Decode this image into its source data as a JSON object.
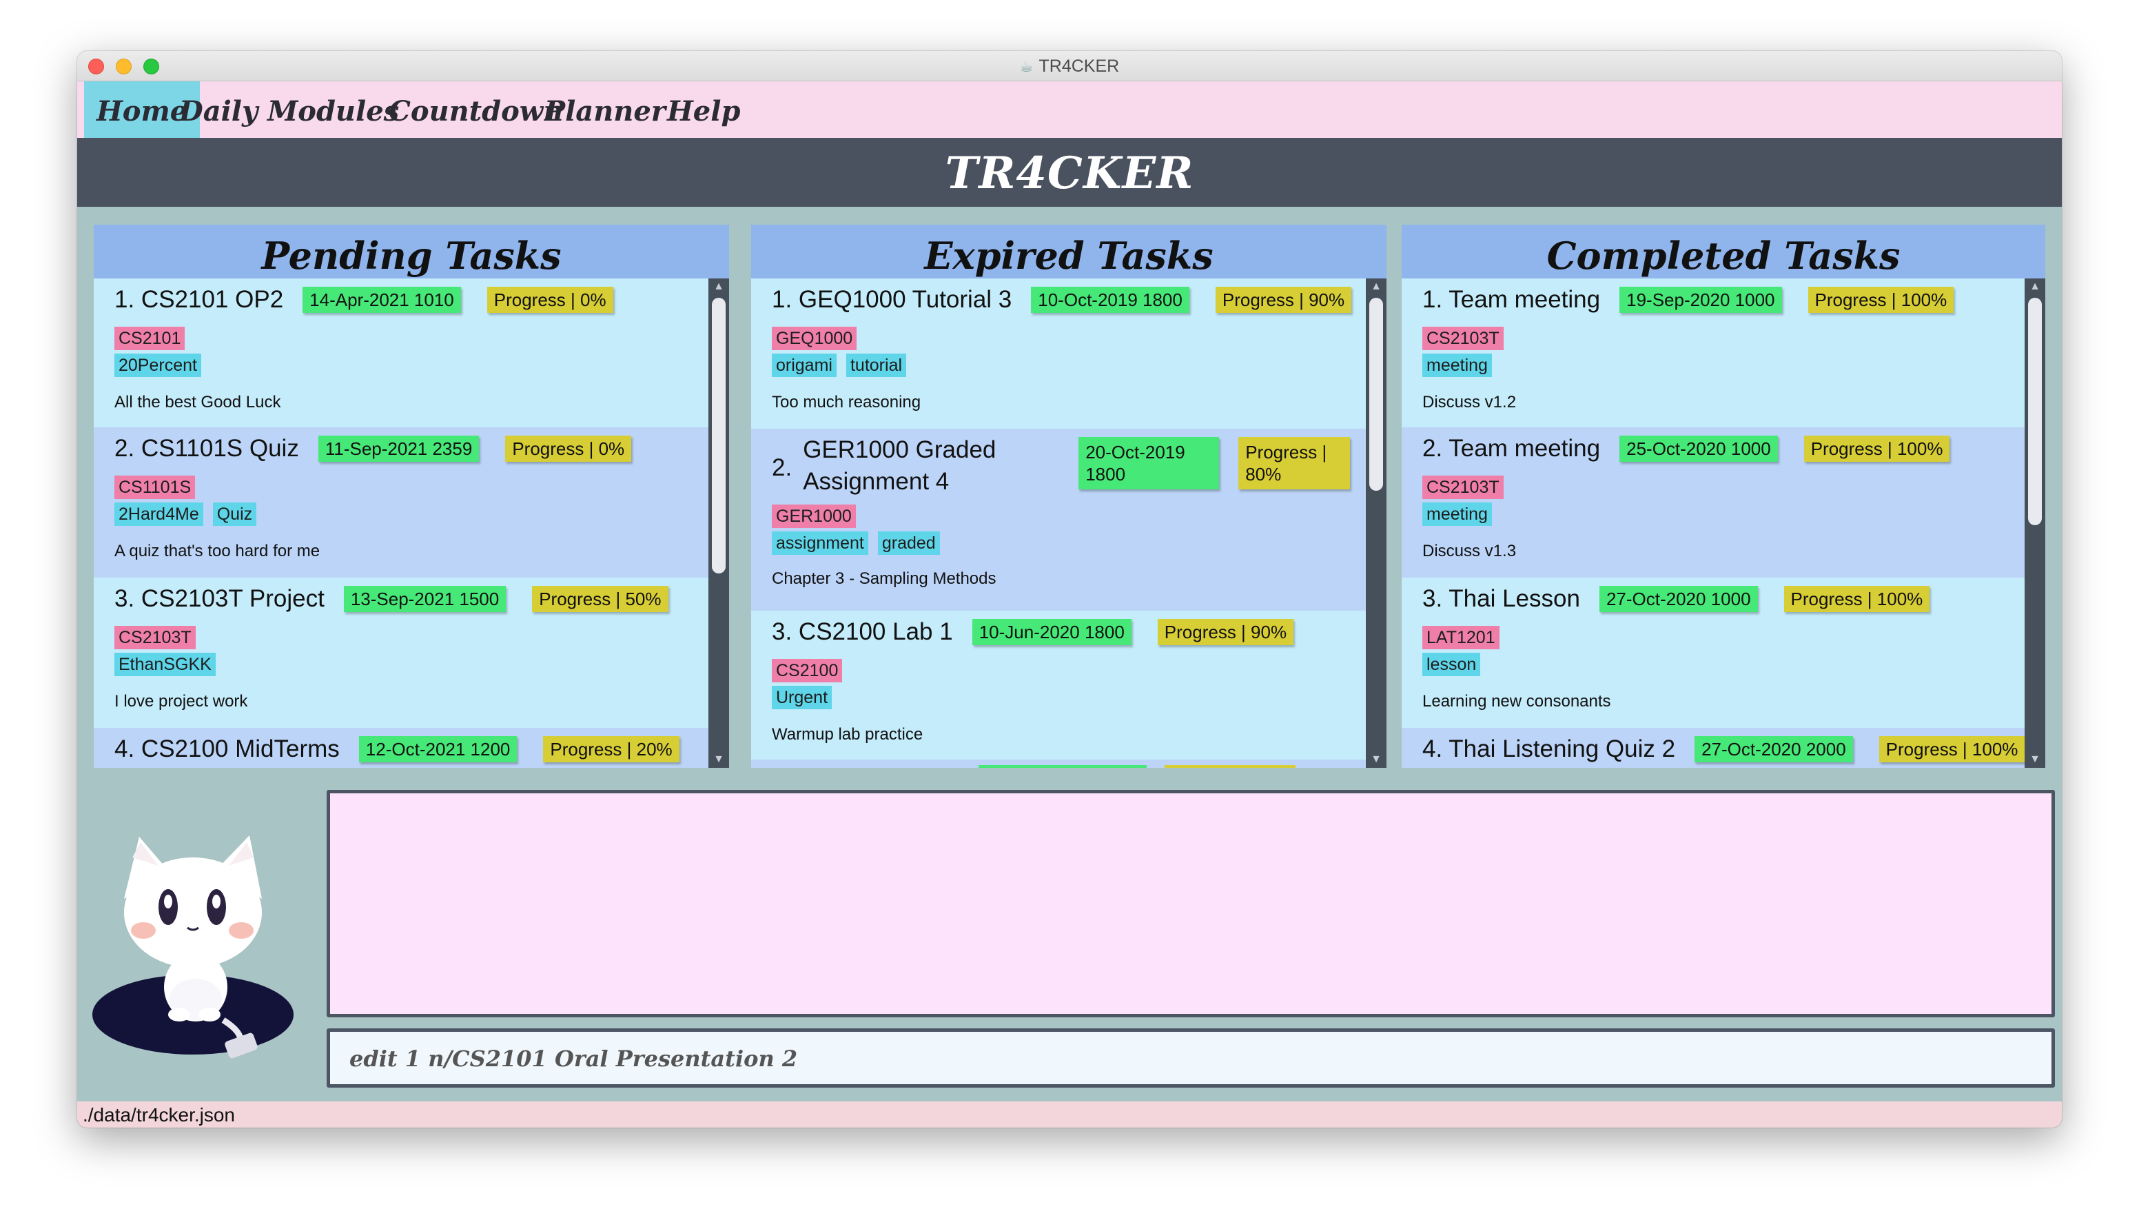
{
  "window": {
    "title": "TR4CKER"
  },
  "menu": {
    "items": [
      "Home",
      "Daily",
      "Modules",
      "Countdown",
      "Planner",
      "Help"
    ],
    "active": "Home"
  },
  "banner": {
    "title": "TR4CKER"
  },
  "panels": {
    "pending": {
      "title": "Pending Tasks",
      "tasks": [
        {
          "title": "1.  CS2101 OP2",
          "date": "14-Apr-2021 1010",
          "progress": "Progress | 0%",
          "module": "CS2101",
          "tags": [
            "20Percent"
          ],
          "desc": "All the best Good Luck"
        },
        {
          "title": "2.  CS1101S Quiz",
          "date": "11-Sep-2021 2359",
          "progress": "Progress | 0%",
          "module": "CS1101S",
          "tags": [
            "2Hard4Me",
            "Quiz"
          ],
          "desc": "A quiz that's too hard for me"
        },
        {
          "title": "3.  CS2103T Project",
          "date": "13-Sep-2021 1500",
          "progress": "Progress | 50%",
          "module": "CS2103T",
          "tags": [
            "EthanSGKK"
          ],
          "desc": "I love project work"
        },
        {
          "title": "4.  CS2100 MidTerms",
          "date": "12-Oct-2021 1200",
          "progress": "Progress | 20%"
        }
      ]
    },
    "expired": {
      "title": "Expired Tasks",
      "tasks": [
        {
          "title": "1.  GEQ1000 Tutorial 3",
          "date": "10-Oct-2019 1800",
          "progress": "Progress | 90%",
          "module": "GEQ1000",
          "tags": [
            "origami",
            "tutorial"
          ],
          "desc": "Too much reasoning"
        },
        {
          "num": "2.",
          "title_line1": "GER1000 Graded",
          "title_line2": "Assignment 4",
          "date_line1": "20-Oct-2019",
          "date_line2": "1800",
          "progress_line1": "Progress |",
          "progress_line2": "80%",
          "module": "GER1000",
          "tags": [
            "assignment",
            "graded"
          ],
          "desc": "Chapter 3 - Sampling Methods"
        },
        {
          "title": "3.  CS2100 Lab 1",
          "date": "10-Jun-2020 1800",
          "progress": "Progress | 90%",
          "module": "CS2100",
          "tags": [
            "Urgent"
          ],
          "desc": "Warmup lab practice"
        }
      ]
    },
    "completed": {
      "title": "Completed Tasks",
      "tasks": [
        {
          "title": "1.  Team meeting",
          "date": "19-Sep-2020 1000",
          "progress": "Progress | 100%",
          "module": "CS2103T",
          "tags": [
            "meeting"
          ],
          "desc": "Discuss v1.2"
        },
        {
          "title": "2.  Team meeting",
          "date": "25-Oct-2020 1000",
          "progress": "Progress | 100%",
          "module": "CS2103T",
          "tags": [
            "meeting"
          ],
          "desc": "Discuss v1.3"
        },
        {
          "title": "3.  Thai Lesson",
          "date": "27-Oct-2020 1000",
          "progress": "Progress | 100%",
          "module": "LAT1201",
          "tags": [
            "lesson"
          ],
          "desc": "Learning new consonants"
        },
        {
          "title": "4.  Thai Listening Quiz 2",
          "date": "27-Oct-2020 2000",
          "progress": "Progress | 100%"
        }
      ]
    }
  },
  "command": {
    "value": "edit 1 n/CS2101 Oral Presentation 2"
  },
  "status": {
    "path": "./data/tr4cker.json"
  },
  "colors": {
    "menubar": "#f9d9ec",
    "banner": "#4a5260",
    "date_badge": "#46e877",
    "progress_badge": "#d7cd35",
    "module_tag": "#ef7fa8",
    "tag": "#5ed5e8"
  }
}
